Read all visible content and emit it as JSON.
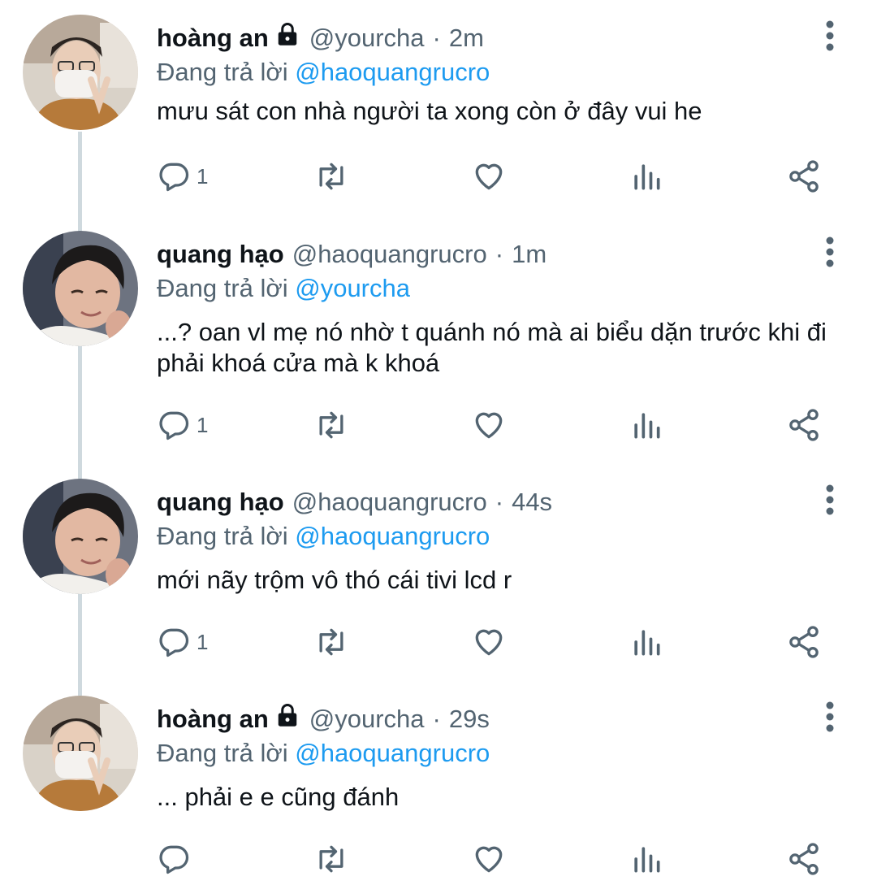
{
  "colors": {
    "text": "#0f1419",
    "secondary": "#536471",
    "link": "#1d9bf0",
    "thread_line": "#cfd9de"
  },
  "tweets": [
    {
      "name": "hoàng an",
      "locked": true,
      "handle": "@yourcha",
      "time": "2m",
      "reply_prefix": "Đang trả lời ",
      "reply_to": "@haoquangrucro",
      "text": "mưu sát con nhà người ta xong còn ở đây vui he",
      "reply_count": "1",
      "avatar": "avatar-hoang-an"
    },
    {
      "name": "quang hạo",
      "locked": false,
      "handle": "@haoquangrucro",
      "time": "1m",
      "reply_prefix": "Đang trả lời ",
      "reply_to": "@yourcha",
      "text": "...? oan vl mẹ nó nhờ t quánh nó mà ai biểu dặn trước khi đi phải khoá cửa mà k khoá",
      "reply_count": "1",
      "avatar": "avatar-quang-hao"
    },
    {
      "name": "quang hạo",
      "locked": false,
      "handle": "@haoquangrucro",
      "time": "44s",
      "reply_prefix": "Đang trả lời ",
      "reply_to": "@haoquangrucro",
      "text": "mới nãy trộm vô thó cái tivi lcd r",
      "reply_count": "1",
      "avatar": "avatar-quang-hao"
    },
    {
      "name": "hoàng an",
      "locked": true,
      "handle": "@yourcha",
      "time": "29s",
      "reply_prefix": "Đang trả lời ",
      "reply_to": "@haoquangrucro",
      "text": "... phải e e cũng đánh",
      "reply_count": "",
      "avatar": "avatar-hoang-an"
    }
  ]
}
